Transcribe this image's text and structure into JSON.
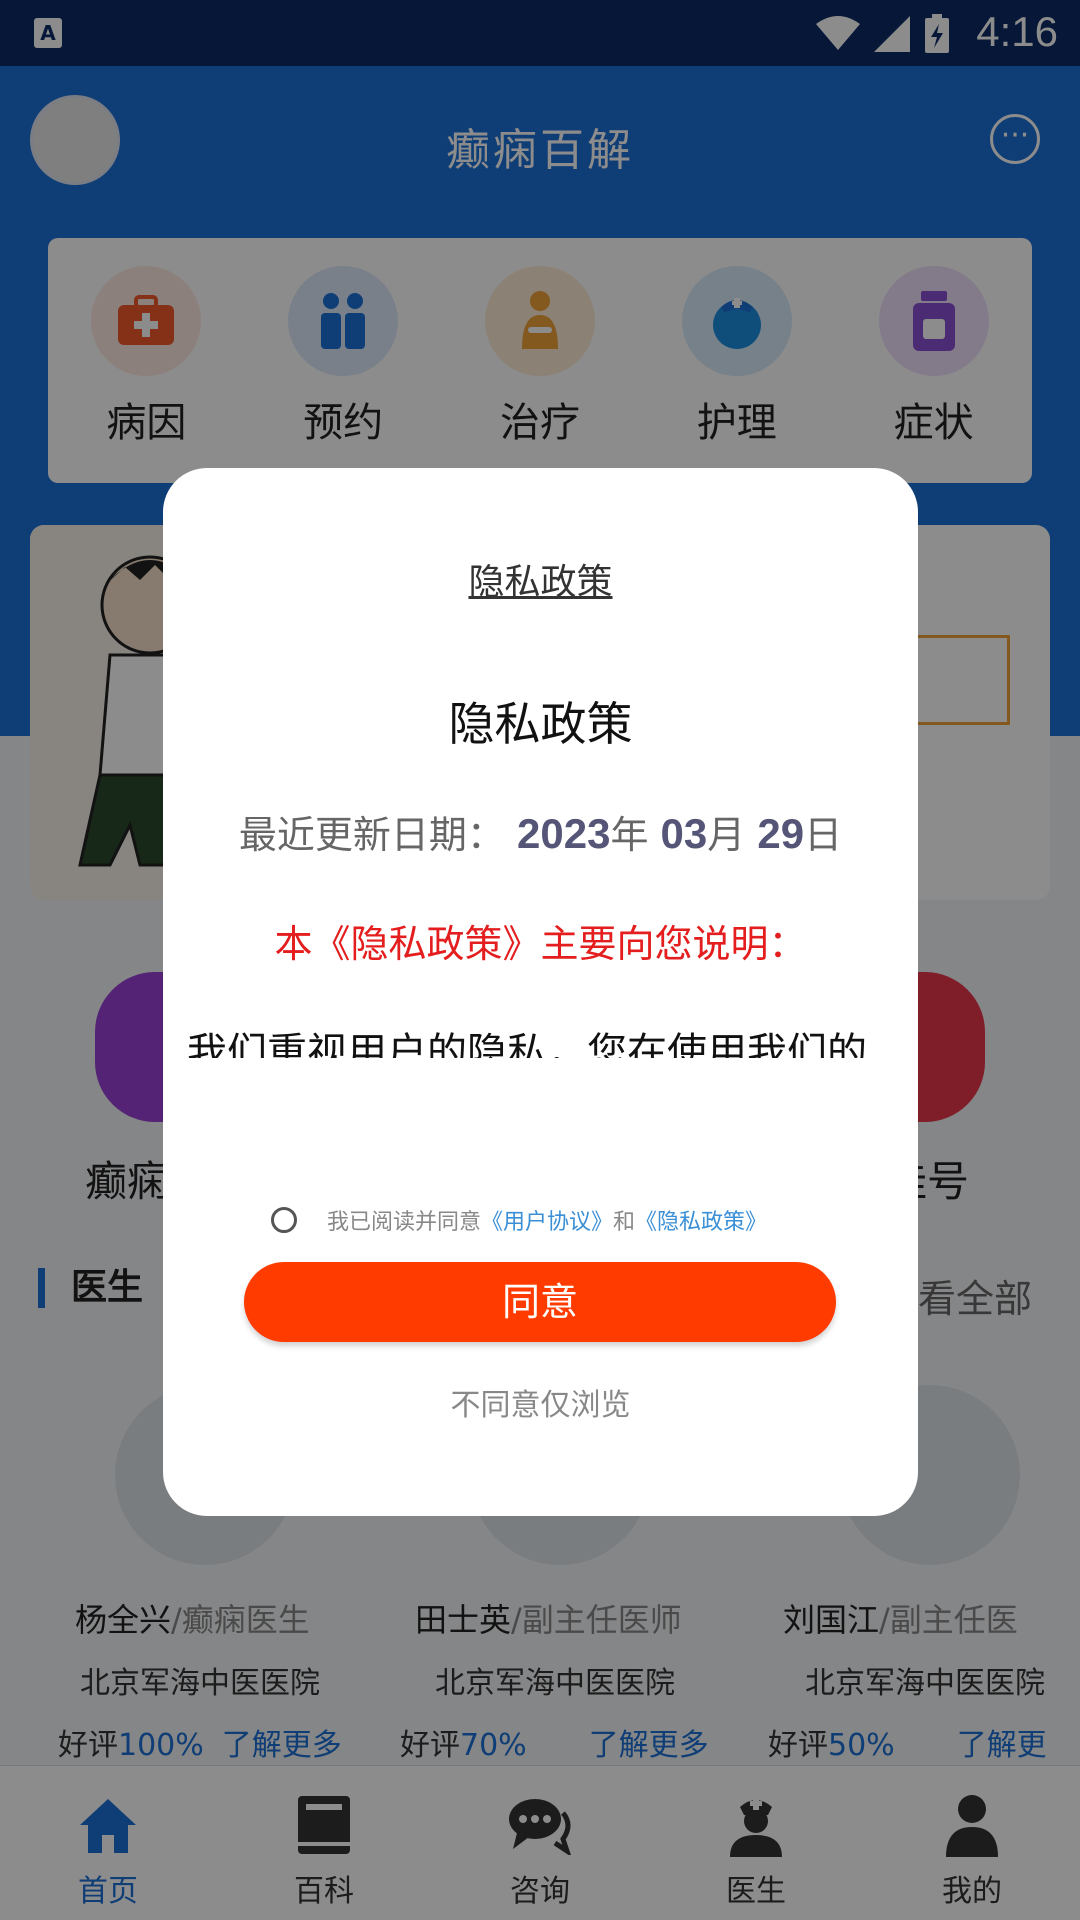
{
  "status_bar": {
    "time": "4:16",
    "app_badge": "A"
  },
  "header": {
    "title": "癫痫百解",
    "more_icon": "more-dots-icon"
  },
  "quick_actions": [
    {
      "label": "病因",
      "icon": "medical-kit-icon",
      "color": "#f05a2a"
    },
    {
      "label": "预约",
      "icon": "people-icon",
      "color": "#1d6fd6"
    },
    {
      "label": "治疗",
      "icon": "patient-icon",
      "color": "#f0a23a"
    },
    {
      "label": "护理",
      "icon": "nurse-icon",
      "color": "#1d8fe0"
    },
    {
      "label": "症状",
      "icon": "medicine-bottle-icon",
      "color": "#8b4fd6"
    }
  ],
  "features": [
    {
      "label": "癫痫",
      "color": "#9a40d6"
    },
    {
      "label": "挂号",
      "color": "#e8384a"
    }
  ],
  "doctors_section": {
    "title": "医生",
    "view_all": "看全部"
  },
  "doctors": [
    {
      "name": "杨全兴",
      "title": "/癫痫医生",
      "hospital": "北京军海中医医院",
      "rating_label": "好评",
      "rating": "100%",
      "more": "了解更多"
    },
    {
      "name": "田士英",
      "title": "/副主任医师",
      "hospital": "北京军海中医医院",
      "rating_label": "好评",
      "rating": "70%",
      "more": "了解更多"
    },
    {
      "name": "刘国江",
      "title": "/副主任医",
      "hospital": "北京军海中医医院",
      "rating_label": "好评",
      "rating": "50%",
      "more": "了解更"
    }
  ],
  "tabbar": [
    {
      "label": "首页",
      "icon": "home-icon",
      "active": true
    },
    {
      "label": "百科",
      "icon": "book-icon",
      "active": false
    },
    {
      "label": "咨询",
      "icon": "chat-icon",
      "active": false
    },
    {
      "label": "医生",
      "icon": "doctor-icon",
      "active": false
    },
    {
      "label": "我的",
      "icon": "user-icon",
      "active": false
    }
  ],
  "dialog": {
    "header_title": "隐私政策",
    "doc_title": "隐私政策",
    "date_label": "最近更新日期：",
    "date_year": "2023",
    "date_year_unit": "年",
    "date_month": "03",
    "date_month_unit": "月",
    "date_day": "29",
    "date_day_unit": "日",
    "red_line": "本《隐私政策》主要向您说明：",
    "partial_paragraph": "我们重视用户的隐私，您在使用我们的",
    "consent_prefix": "我已阅读并同意",
    "consent_link_1": "《用户协议》",
    "consent_and": "和",
    "consent_link_2": "《隐私政策》",
    "agree_label": "同意",
    "browse_label": "不同意仅浏览"
  }
}
